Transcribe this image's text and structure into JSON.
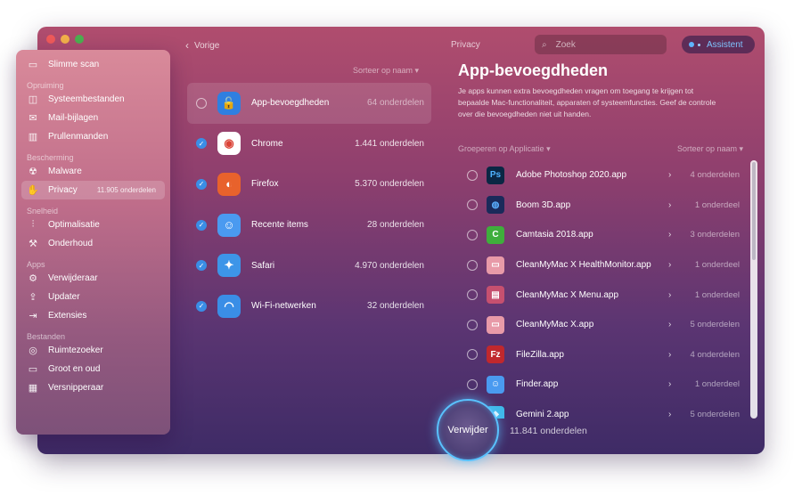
{
  "window": {
    "traffic_colors": [
      "#ef5a5a",
      "#f2b04a",
      "#4caf50"
    ]
  },
  "topbar": {
    "back_label": "Vorige",
    "crumb": "Privacy",
    "search_placeholder": "Zoek",
    "assistant_label": "Assistent"
  },
  "sidebar": {
    "top": {
      "label": "Slimme scan",
      "icon": "scan-icon"
    },
    "sections": [
      {
        "title": "Opruiming",
        "items": [
          {
            "label": "Systeembestanden",
            "icon": "system-files-icon"
          },
          {
            "label": "Mail-bijlagen",
            "icon": "mail-icon"
          },
          {
            "label": "Prullenmanden",
            "icon": "trash-icon"
          }
        ]
      },
      {
        "title": "Bescherming",
        "items": [
          {
            "label": "Malware",
            "icon": "biohazard-icon"
          },
          {
            "label": "Privacy",
            "icon": "hand-icon",
            "count": "11.905 onderdelen",
            "active": true
          }
        ]
      },
      {
        "title": "Snelheid",
        "items": [
          {
            "label": "Optimalisatie",
            "icon": "sliders-icon"
          },
          {
            "label": "Onderhoud",
            "icon": "wrench-icon"
          }
        ]
      },
      {
        "title": "Apps",
        "items": [
          {
            "label": "Verwijderaar",
            "icon": "uninstaller-icon"
          },
          {
            "label": "Updater",
            "icon": "updater-icon"
          },
          {
            "label": "Extensies",
            "icon": "extensions-icon"
          }
        ]
      },
      {
        "title": "Bestanden",
        "items": [
          {
            "label": "Ruimtezoeker",
            "icon": "space-lens-icon"
          },
          {
            "label": "Groot en oud",
            "icon": "folder-icon"
          },
          {
            "label": "Versnipperaar",
            "icon": "shredder-icon"
          }
        ]
      }
    ]
  },
  "middle": {
    "sort_label": "Sorteer op naam ▾",
    "items": [
      {
        "label": "App-bevoegdheden",
        "count": "64 onderdelen",
        "checked": false,
        "selected": true,
        "icon": "lock-icon",
        "color": "#2f7fe0",
        "glyph": "🔓"
      },
      {
        "label": "Chrome",
        "count": "1.441 onderdelen",
        "checked": true,
        "icon": "chrome-icon",
        "color": "#ffffff",
        "glyph": "◉"
      },
      {
        "label": "Firefox",
        "count": "5.370 onderdelen",
        "checked": true,
        "icon": "firefox-icon",
        "color": "#e8622c",
        "glyph": "◐"
      },
      {
        "label": "Recente items",
        "count": "28 onderdelen",
        "checked": true,
        "icon": "finder-icon",
        "color": "#4a9af0",
        "glyph": "☺"
      },
      {
        "label": "Safari",
        "count": "4.970 onderdelen",
        "checked": true,
        "icon": "safari-icon",
        "color": "#3d95e8",
        "glyph": "✦"
      },
      {
        "label": "Wi-Fi-netwerken",
        "count": "32 onderdelen",
        "checked": true,
        "icon": "wifi-icon",
        "color": "#3a8ee6",
        "glyph": "◠"
      }
    ]
  },
  "detail": {
    "title": "App-bevoegdheden",
    "description": "Je apps kunnen extra bevoegdheden vragen om toegang te krijgen tot bepaalde Mac-functionaliteit, apparaten of systeemfuncties. Geef de controle over die bevoegdheden niet uit handen.",
    "group_label": "Groeperen op Applicatie ▾",
    "sort_label": "Sorteer op naam ▾",
    "apps": [
      {
        "label": "Adobe Photoshop 2020.app",
        "count": "4 onderdelen",
        "icon": "photoshop-icon",
        "color": "#0b2744",
        "glyph": "Ps",
        "fg": "#4fb3ff"
      },
      {
        "label": "Boom 3D.app",
        "count": "1 onderdeel",
        "icon": "boom-icon",
        "color": "#1a2a5a",
        "glyph": "◍",
        "fg": "#5bb0ff"
      },
      {
        "label": "Camtasia 2018.app",
        "count": "3 onderdelen",
        "icon": "camtasia-icon",
        "color": "#3fae3c",
        "glyph": "C",
        "fg": "#ffffff"
      },
      {
        "label": "CleanMyMac X HealthMonitor.app",
        "count": "1 onderdeel",
        "icon": "cleanmymac-monitor-icon",
        "color": "#e89aa8",
        "glyph": "▭",
        "fg": "#ffffff"
      },
      {
        "label": "CleanMyMac X Menu.app",
        "count": "1 onderdeel",
        "icon": "cleanmymac-menu-icon",
        "color": "#c6506f",
        "glyph": "▤",
        "fg": "#ffffff"
      },
      {
        "label": "CleanMyMac X.app",
        "count": "5 onderdelen",
        "icon": "cleanmymac-icon",
        "color": "#e89aa8",
        "glyph": "▭",
        "fg": "#ffffff"
      },
      {
        "label": "FileZilla.app",
        "count": "4 onderdelen",
        "icon": "filezilla-icon",
        "color": "#c0282d",
        "glyph": "Fz",
        "fg": "#ffffff"
      },
      {
        "label": "Finder.app",
        "count": "1 onderdeel",
        "icon": "finder-icon",
        "color": "#4a9af0",
        "glyph": "☺",
        "fg": "#ffffff"
      },
      {
        "label": "Gemini 2.app",
        "count": "5 onderdelen",
        "icon": "gemini-icon",
        "color": "#3fb8e8",
        "glyph": "◆",
        "fg": "#ffffff"
      }
    ]
  },
  "footer": {
    "remove_label": "Verwijder",
    "total": "11.841 onderdelen"
  }
}
